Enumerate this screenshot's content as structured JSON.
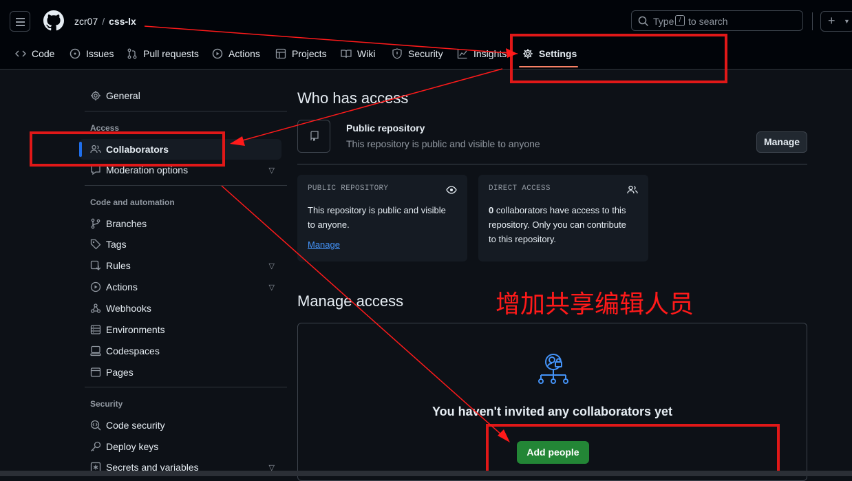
{
  "header": {
    "owner": "zcr07",
    "repo": "css-lx",
    "search_type": "Type",
    "search_key": "/",
    "search_rest": "to search"
  },
  "repo_nav": [
    {
      "label": "Code",
      "icon": "code-icon"
    },
    {
      "label": "Issues",
      "icon": "issue-icon"
    },
    {
      "label": "Pull requests",
      "icon": "pull-request-icon"
    },
    {
      "label": "Actions",
      "icon": "play-icon"
    },
    {
      "label": "Projects",
      "icon": "table-icon"
    },
    {
      "label": "Wiki",
      "icon": "book-icon"
    },
    {
      "label": "Security",
      "icon": "shield-icon"
    },
    {
      "label": "Insights",
      "icon": "graph-icon"
    },
    {
      "label": "Settings",
      "icon": "gear-icon",
      "active": true
    }
  ],
  "sidebar": {
    "general": "General",
    "access_heading": "Access",
    "collaborators": "Collaborators",
    "moderation": "Moderation options",
    "code_heading": "Code and automation",
    "branches": "Branches",
    "tags": "Tags",
    "rules": "Rules",
    "actions": "Actions",
    "webhooks": "Webhooks",
    "environments": "Environments",
    "codespaces": "Codespaces",
    "pages": "Pages",
    "security_heading": "Security",
    "code_security": "Code security",
    "deploy_keys": "Deploy keys",
    "secrets": "Secrets and variables"
  },
  "main": {
    "who_title": "Who has access",
    "public_title": "Public repository",
    "public_desc": "This repository is public and visible to anyone",
    "manage_btn": "Manage",
    "card1": {
      "header": "PUBLIC REPOSITORY",
      "line1": "This repository is public and visible",
      "line2": "to anyone.",
      "link": "Manage"
    },
    "card2": {
      "header": "DIRECT ACCESS",
      "count": "0",
      "line1": " collaborators have access to this",
      "line2": "repository. Only you can contribute",
      "line3": "to this repository."
    },
    "manage_access_title": "Manage access",
    "empty_state": "You haven't invited any collaborators yet",
    "add_people": "Add people"
  },
  "annotation": {
    "text": "增加共享编辑人员",
    "color": "#ff1a1a"
  },
  "colors": {
    "bg": "#0d1117",
    "topbar": "#010409",
    "accent_blue": "#1f6feb",
    "link": "#4493f8",
    "green_button": "#238636",
    "tab_underline": "#f78166"
  }
}
